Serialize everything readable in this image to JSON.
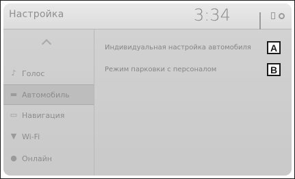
{
  "header": {
    "title": "Настройка",
    "clock": "3:34",
    "status_icons": [
      "signal-icon",
      "battery-icon",
      "settings-icon"
    ]
  },
  "sidebar": {
    "items": [
      {
        "label": "Голос",
        "icon": "voice-icon",
        "selected": false
      },
      {
        "label": "Автомобиль",
        "icon": "car-icon",
        "selected": true
      },
      {
        "label": "Навигация",
        "icon": "navigation-icon",
        "selected": false
      },
      {
        "label": "Wi-Fi",
        "icon": "wifi-icon",
        "selected": false
      },
      {
        "label": "Онлайн",
        "icon": "online-icon",
        "selected": false
      }
    ]
  },
  "main": {
    "options": [
      {
        "label": "Индивидуальная настройка автомобиля",
        "badge": "A"
      },
      {
        "label": "Режим парковки с персоналом",
        "badge": "B"
      }
    ]
  }
}
